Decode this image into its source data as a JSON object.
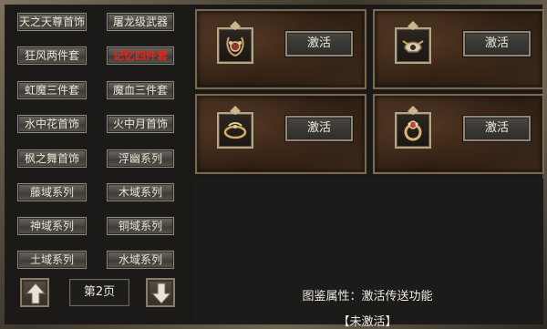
{
  "set_list": [
    {
      "label": "天之天尊首饰",
      "active": false
    },
    {
      "label": "屠龙级武器",
      "active": false
    },
    {
      "label": "狂风两件套",
      "active": false
    },
    {
      "label": "记忆四件套",
      "active": true
    },
    {
      "label": "虹魔三件套",
      "active": false
    },
    {
      "label": "魔血三件套",
      "active": false
    },
    {
      "label": "水中花首饰",
      "active": false
    },
    {
      "label": "火中月首饰",
      "active": false
    },
    {
      "label": "枫之舞首饰",
      "active": false
    },
    {
      "label": "浮幽系列",
      "active": false
    },
    {
      "label": "藤域系列",
      "active": false
    },
    {
      "label": "木域系列",
      "active": false
    },
    {
      "label": "神域系列",
      "active": false
    },
    {
      "label": "铜域系列",
      "active": false
    },
    {
      "label": "土域系列",
      "active": false
    },
    {
      "label": "水域系列",
      "active": false
    }
  ],
  "pagination": {
    "page_label": "第2页",
    "up_icon": "arrow-up-icon",
    "down_icon": "arrow-down-icon"
  },
  "slots": [
    {
      "item_icon": "necklace-icon",
      "button_label": "激活"
    },
    {
      "item_icon": "helmet-icon",
      "button_label": "激活"
    },
    {
      "item_icon": "bracelet-icon",
      "button_label": "激活"
    },
    {
      "item_icon": "ring-icon",
      "button_label": "激活"
    }
  ],
  "attributes": {
    "description": "图鉴属性：激活传送功能",
    "status": "【未激活】"
  },
  "colors": {
    "active_text": "#e4261b",
    "normal_text": "#e9e4d8"
  }
}
